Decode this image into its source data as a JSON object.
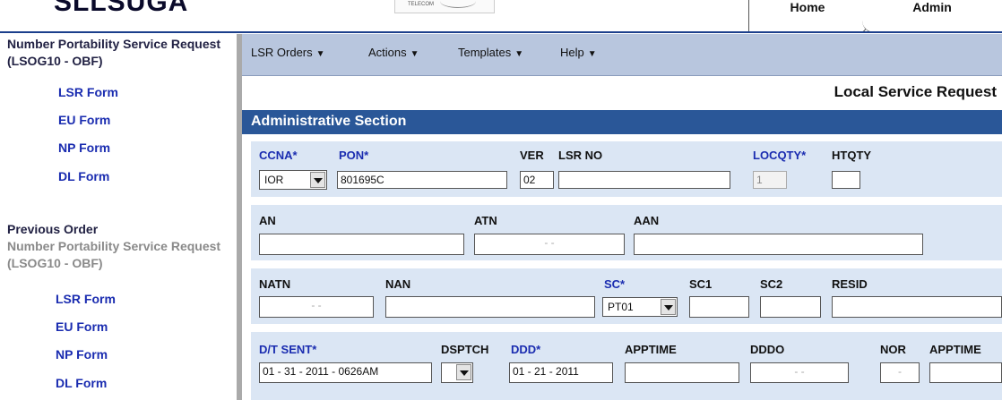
{
  "header": {
    "logo_text": "SLLSUGA",
    "telecom_text": "TELECOM",
    "tabs": [
      "Home",
      "Admin"
    ]
  },
  "sidebar": {
    "current_title": "Number Portability Service Request (LSOG10 - OBF)",
    "current_links": [
      "LSR Form",
      "EU Form",
      "NP Form",
      "DL Form"
    ],
    "previous_heading": "Previous Order",
    "previous_title": "Number Portability Service Request (LSOG10 - OBF)",
    "previous_links": [
      "LSR Form",
      "EU Form",
      "NP Form",
      "DL Form"
    ]
  },
  "menu": {
    "items": [
      "LSR Orders",
      "Actions",
      "Templates",
      "Help"
    ]
  },
  "page": {
    "request_title": "Local Service Request",
    "section_title": "Administrative Section"
  },
  "form": {
    "ccna_label": "CCNA*",
    "ccna_value": "IOR",
    "pon_label": "PON*",
    "pon_value": "801695C",
    "ver_label": "VER",
    "ver_value": "02",
    "lsrno_label": "LSR NO",
    "lsrno_value": "",
    "locqty_label": "LOCQTY*",
    "locqty_value": "1",
    "htqty_label": "HTQTY",
    "htqty_value": "",
    "an_label": "AN",
    "an_value": "",
    "atn_label": "ATN",
    "atn_value": "-        -",
    "aan_label": "AAN",
    "aan_value": "",
    "natn_label": "NATN",
    "natn_value": "-        -",
    "nan_label": "NAN",
    "nan_value": "",
    "sc_label": "SC*",
    "sc_value": "PT01",
    "sc1_label": "SC1",
    "sc1_value": "",
    "sc2_label": "SC2",
    "sc2_value": "",
    "resid_label": "RESID",
    "resid_value": "",
    "dtsent_label": "D/T SENT*",
    "dtsent_value": "01 - 31 - 2011 - 0626AM",
    "dsptch_label": "DSPTCH",
    "dsptch_value": "",
    "ddd_label": "DDD*",
    "ddd_value": "01 - 21 - 2011",
    "apptime_label": "APPTIME",
    "apptime_value": "",
    "dddo_label": "DDDO",
    "dddo_value": "-      -",
    "nor_label": "NOR",
    "nor_value": "-",
    "apptime2_label": "APPTIME",
    "apptime2_value": ""
  }
}
